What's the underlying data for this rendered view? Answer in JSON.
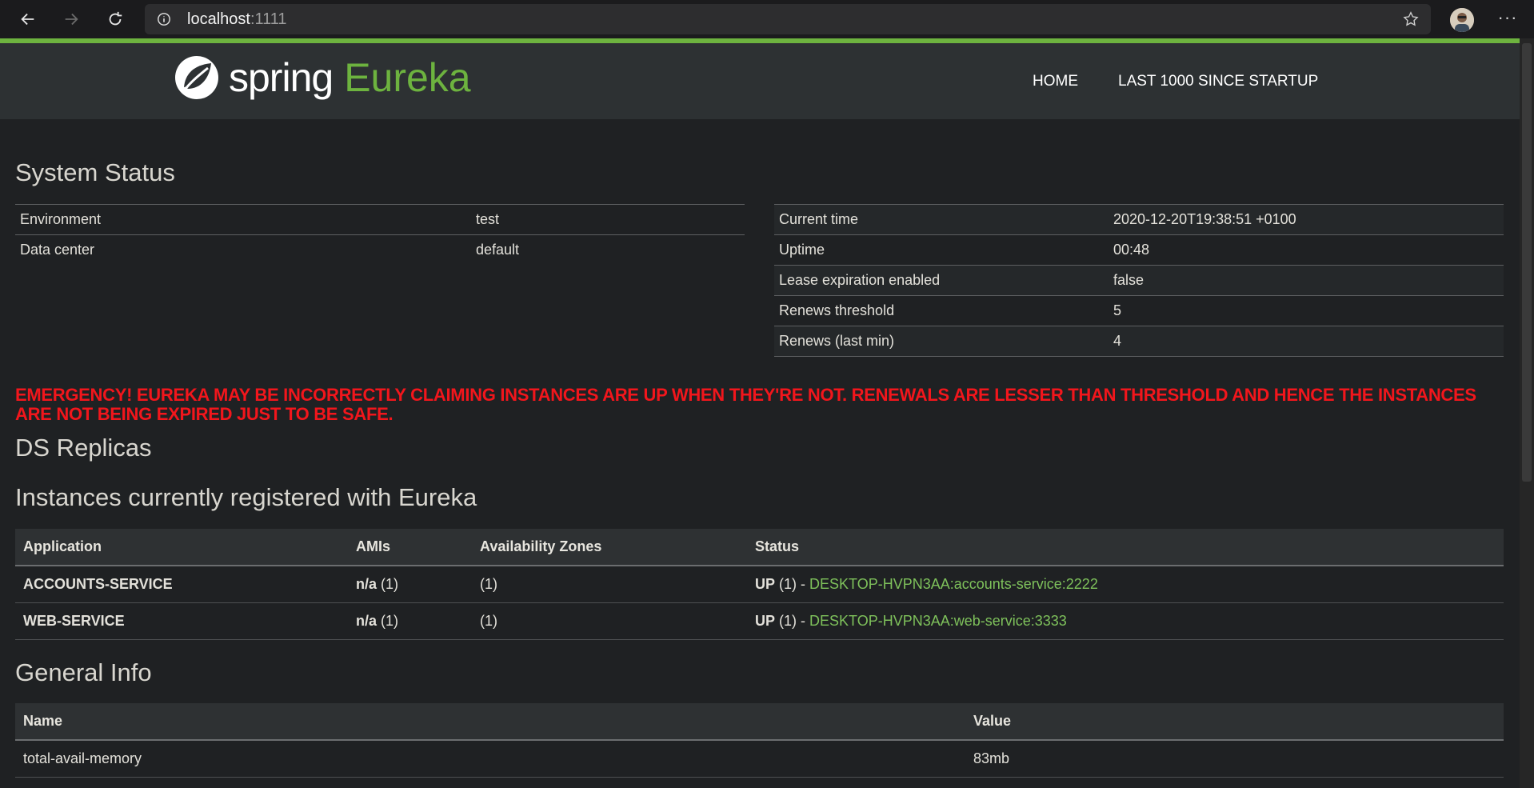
{
  "browser": {
    "url_host": "localhost",
    "url_port": ":1111"
  },
  "navbar": {
    "logo_word": "spring",
    "logo_product": "Eureka",
    "links": [
      "HOME",
      "LAST 1000 SINCE STARTUP"
    ]
  },
  "system_status": {
    "title": "System Status",
    "left": [
      {
        "label": "Environment",
        "value": "test"
      },
      {
        "label": "Data center",
        "value": "default"
      }
    ],
    "right": [
      {
        "label": "Current time",
        "value": "2020-12-20T19:38:51 +0100"
      },
      {
        "label": "Uptime",
        "value": "00:48"
      },
      {
        "label": "Lease expiration enabled",
        "value": "false"
      },
      {
        "label": "Renews threshold",
        "value": "5"
      },
      {
        "label": "Renews (last min)",
        "value": "4"
      }
    ]
  },
  "warning": "EMERGENCY! EUREKA MAY BE INCORRECTLY CLAIMING INSTANCES ARE UP WHEN THEY'RE NOT. RENEWALS ARE LESSER THAN THRESHOLD AND HENCE THE INSTANCES ARE NOT BEING EXPIRED JUST TO BE SAFE.",
  "ds_replicas": {
    "title": "DS Replicas"
  },
  "instances": {
    "title": "Instances currently registered with Eureka",
    "headers": [
      "Application",
      "AMIs",
      "Availability Zones",
      "Status"
    ],
    "rows": [
      {
        "app": "ACCOUNTS-SERVICE",
        "ami_bold": "n/a",
        "ami_count": " (1)",
        "zones": "(1)",
        "status_bold": "UP",
        "status_count": " (1) - ",
        "instance": "DESKTOP-HVPN3AA:accounts-service:2222"
      },
      {
        "app": "WEB-SERVICE",
        "ami_bold": "n/a",
        "ami_count": " (1)",
        "zones": "(1)",
        "status_bold": "UP",
        "status_count": " (1) - ",
        "instance": "DESKTOP-HVPN3AA:web-service:3333"
      }
    ]
  },
  "general_info": {
    "title": "General Info",
    "headers": [
      "Name",
      "Value"
    ],
    "rows": [
      {
        "name": "total-avail-memory",
        "value": "83mb"
      }
    ]
  },
  "colors": {
    "accent": "#6db33f",
    "warning": "#f2161c",
    "link": "#7ec15b"
  }
}
